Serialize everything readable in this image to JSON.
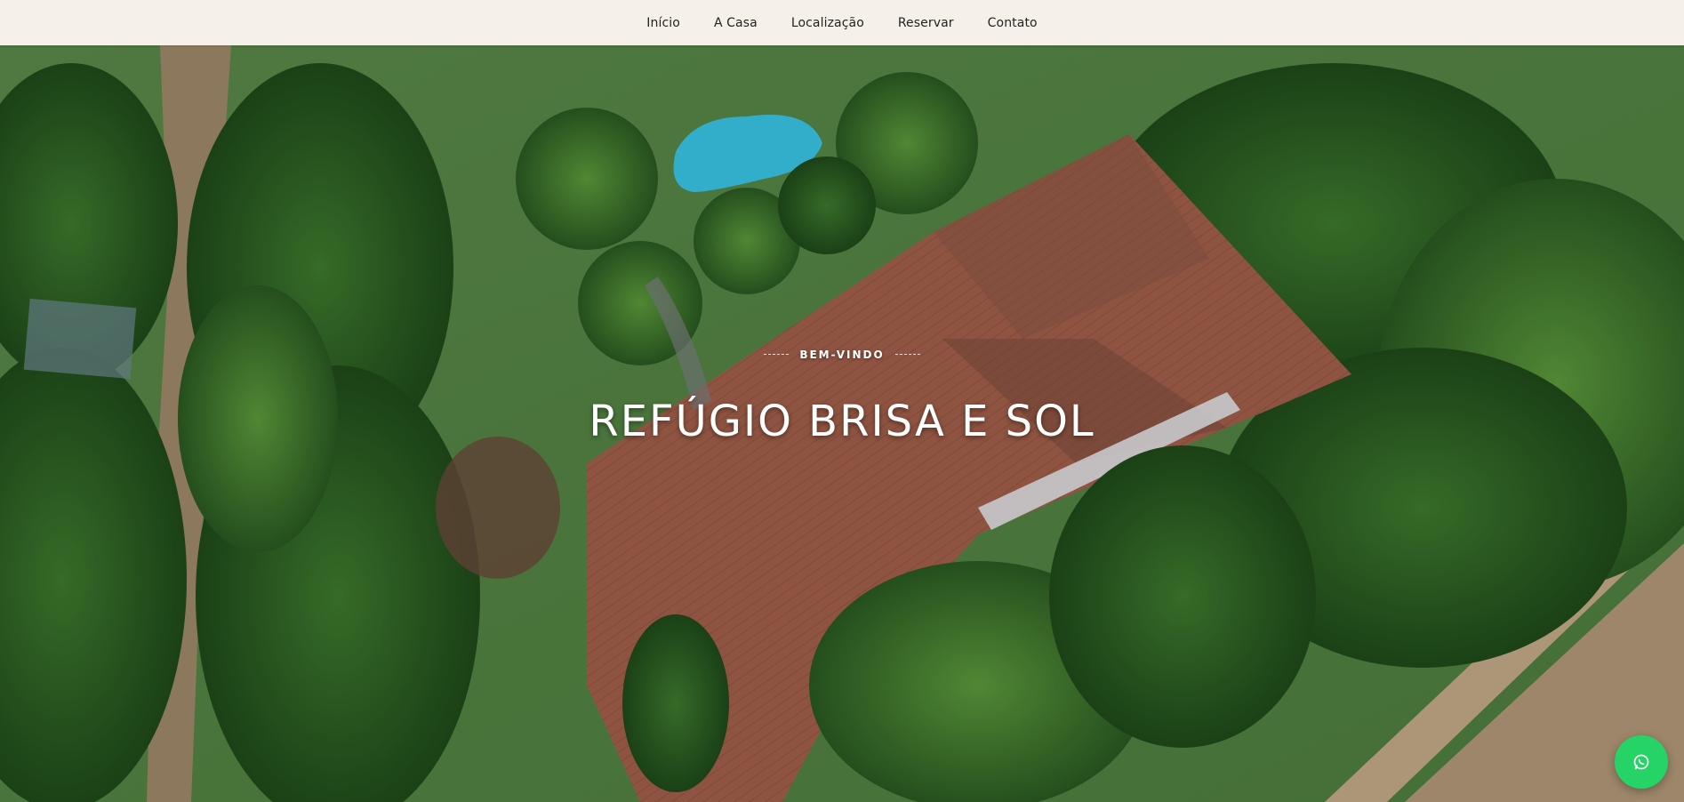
{
  "nav": {
    "items": [
      {
        "label": "Início"
      },
      {
        "label": "A Casa"
      },
      {
        "label": "Localização"
      },
      {
        "label": "Reservar"
      },
      {
        "label": "Contato"
      }
    ]
  },
  "hero": {
    "eyebrow": "BEM-VINDO",
    "title": "REFÚGIO BRISA E SOL",
    "background": "aerial photo of house with tiled roof, pool and garden"
  },
  "floating": {
    "whatsapp_icon": "whatsapp-icon"
  },
  "colors": {
    "nav_bg": "#f5f1e8",
    "whatsapp": "#25d366",
    "roof": "#a8644f"
  }
}
